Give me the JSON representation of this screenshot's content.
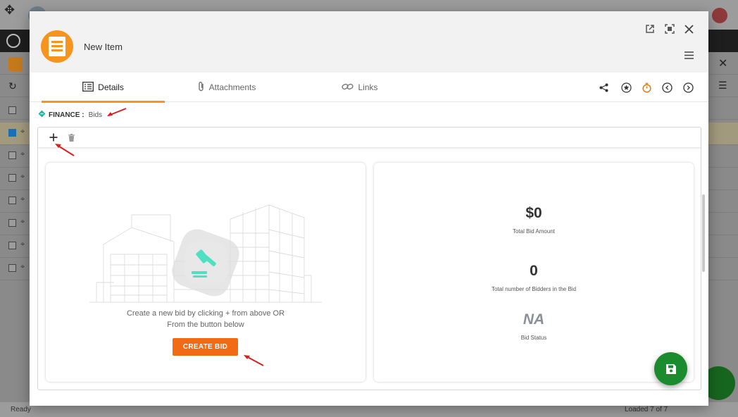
{
  "modal": {
    "title": "New Item",
    "tabs": [
      {
        "label": "Details",
        "icon": "details-icon",
        "active": true
      },
      {
        "label": "Attachments",
        "icon": "paperclip-icon",
        "active": false
      },
      {
        "label": "Links",
        "icon": "link-icon",
        "active": false
      }
    ],
    "breadcrumb": {
      "module": "FINANCE :",
      "submodule": "Bids"
    }
  },
  "bids": {
    "empty_line1": "Create a new bid by clicking + from above OR",
    "empty_line2": "From the button below",
    "create_button": "CREATE BID"
  },
  "summary": {
    "total_bid_amount": {
      "value": "$0",
      "label": "Total Bid Amount"
    },
    "bidder_count": {
      "value": "0",
      "label": "Total number of Bidders in the Bid"
    },
    "bid_status": {
      "value": "NA",
      "label": "Bid Status"
    }
  },
  "background": {
    "status_left": "Ready",
    "status_right": "Loaded 7 of 7"
  },
  "colors": {
    "accent": "#f7941d",
    "create_button": "#f26a13",
    "save_fab": "#1a8c2e",
    "annotation_arrow": "#d42020"
  }
}
